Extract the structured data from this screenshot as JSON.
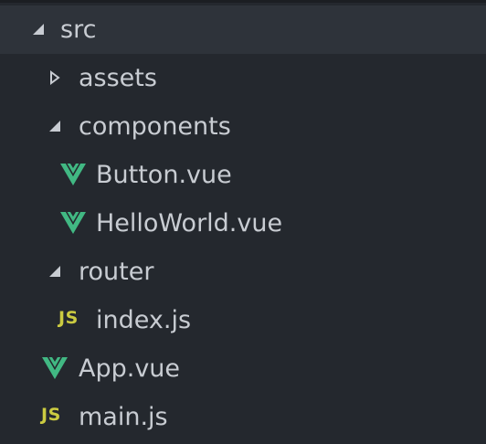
{
  "tree": {
    "root": {
      "label": "src",
      "expanded": true
    },
    "assets": {
      "label": "assets",
      "expanded": false
    },
    "components": {
      "label": "components",
      "expanded": true
    },
    "button_vue": {
      "label": "Button.vue",
      "icon": "vue-icon"
    },
    "helloworld_vue": {
      "label": "HelloWorld.vue",
      "icon": "vue-icon"
    },
    "router": {
      "label": "router",
      "expanded": true
    },
    "index_js": {
      "label": "index.js",
      "icon": "js-icon",
      "icon_text": "JS"
    },
    "app_vue": {
      "label": "App.vue",
      "icon": "vue-icon"
    },
    "main_js": {
      "label": "main.js",
      "icon": "js-icon",
      "icon_text": "JS"
    }
  },
  "colors": {
    "background": "#24282e",
    "selected_row": "#2e333a",
    "text": "#c8ccd2",
    "vue_green": "#41b883",
    "js_yellow": "#cbcb41"
  }
}
